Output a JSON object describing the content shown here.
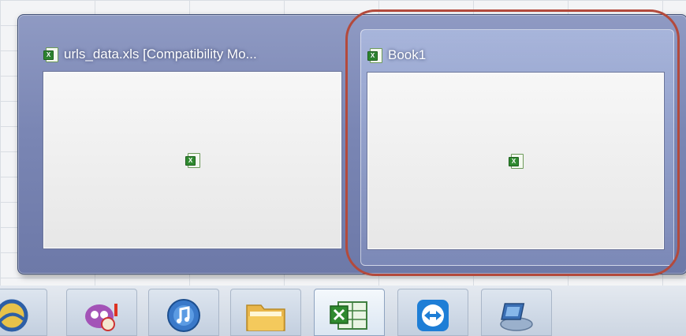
{
  "thumbnails": [
    {
      "title": "urls_data.xls  [Compatibility Mo...",
      "icon": "excel-file-icon"
    },
    {
      "title": "Book1",
      "icon": "excel-file-icon",
      "highlighted": true
    }
  ],
  "taskbar": {
    "buttons": [
      {
        "icon": "java-icon"
      },
      {
        "icon": "messenger-icon"
      },
      {
        "icon": "itunes-icon"
      },
      {
        "icon": "folder-icon"
      },
      {
        "icon": "excel-icon",
        "active": true
      },
      {
        "icon": "teamviewer-icon"
      },
      {
        "icon": "network-icon"
      }
    ]
  },
  "colors": {
    "highlight_ring": "#b34a3c",
    "panel": "#7a86b4",
    "excel_green": "#2f8a2f"
  }
}
